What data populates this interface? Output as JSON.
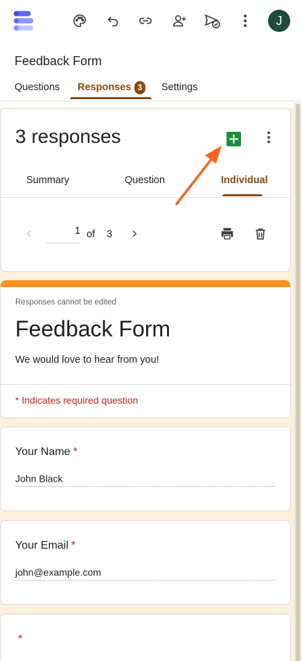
{
  "app": {
    "title": "Feedback Form",
    "avatar_initial": "J",
    "accent": "#8a4a0f",
    "form_theme": "#fb9321"
  },
  "toolbar": {
    "icons": [
      "google-forms-logo",
      "palette-icon",
      "undo-icon",
      "link-icon",
      "add-collaborator-icon",
      "send-preview-icon",
      "more-vert-icon"
    ]
  },
  "tabs": [
    {
      "label": "Questions"
    },
    {
      "label": "Responses",
      "badge": "3",
      "active": true
    },
    {
      "label": "Settings"
    }
  ],
  "responses": {
    "count_label": "3 responses",
    "sub_tabs": [
      {
        "label": "Summary"
      },
      {
        "label": "Question"
      },
      {
        "label": "Individual",
        "active": true
      }
    ],
    "pager": {
      "current": "1",
      "of_label": "of",
      "total": "3"
    }
  },
  "form": {
    "note": "Responses cannot be edited",
    "title": "Feedback Form",
    "description": "We would love to hear from you!",
    "required_note": "* Indicates required question"
  },
  "questions": [
    {
      "label": "Your Name",
      "required_mark": "*",
      "answer": "John Black"
    },
    {
      "label": "Your Email",
      "required_mark": "*",
      "answer": "john@example.com"
    },
    {
      "label": "",
      "required_mark": "*",
      "answer": ""
    }
  ]
}
